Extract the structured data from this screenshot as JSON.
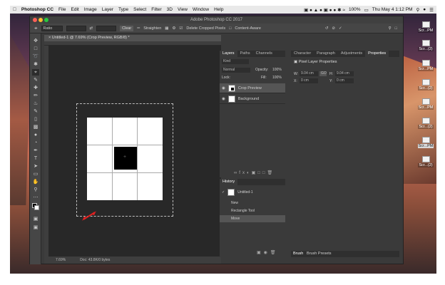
{
  "menubar": {
    "app": "Photoshop CC",
    "items": [
      "File",
      "Edit",
      "Image",
      "Layer",
      "Type",
      "Select",
      "Filter",
      "3D",
      "View",
      "Window",
      "Help"
    ],
    "battery": "100%",
    "clock": "Thu May 4 1:12 PM"
  },
  "window": {
    "title": "Adobe Photoshop CC 2017"
  },
  "options": {
    "ratio": "Ratio",
    "clear": "Clear",
    "straighten": "Straighten",
    "delete_cropped": "Delete Cropped Pixels",
    "content_aware": "Content-Aware"
  },
  "document": {
    "tab": "Untitled-1 @ 7.69% (Crop Preview, RGB/8) *",
    "zoom": "7.69%",
    "doc_info": "Doc: 43.8K/0 bytes"
  },
  "layers_panel": {
    "tabs": [
      "Layers",
      "Paths",
      "Channels"
    ],
    "active_tab": "Layers",
    "blend_mode": "Normal",
    "opacity_label": "Opacity:",
    "opacity": "100%",
    "lock_label": "Lock:",
    "fill_label": "Fill:",
    "fill": "100%",
    "kind": "Kind",
    "layers": [
      {
        "name": "Crop Preview",
        "thumb": "black-square"
      },
      {
        "name": "Background",
        "thumb": "white"
      }
    ]
  },
  "history_panel": {
    "title": "History",
    "snapshot": "Untitled-1",
    "items": [
      "New",
      "Rectangle Tool",
      "Move"
    ],
    "selected": "Move"
  },
  "properties_panel": {
    "tabs": [
      "Character",
      "Paragraph",
      "Adjustments",
      "Properties"
    ],
    "active_tab": "Properties",
    "heading": "Pixel Layer Properties",
    "w_label": "W:",
    "w": "9.04 cm",
    "h_label": "H:",
    "h": "9.04 cm",
    "x_label": "X:",
    "x": "0 cm",
    "y_label": "Y:",
    "y": "0 cm",
    "link": "GO"
  },
  "brush_panel": {
    "tabs": [
      "Brush",
      "Brush Presets"
    ],
    "active_tab": "Brush"
  },
  "desktop_icons": [
    {
      "label": "Scr...PM"
    },
    {
      "label": "Scr...(2)"
    },
    {
      "label": "Scr...PM"
    },
    {
      "label": "Scr...(2)"
    },
    {
      "label": "Scr...PM"
    },
    {
      "label": "Scr...(2)"
    },
    {
      "label": "Scr...PM"
    },
    {
      "label": "Scr...(2)"
    }
  ],
  "colors": {
    "accent_arrow": "#e02020",
    "panel_bg": "#3a3a3a",
    "canvas_bg": "#282828"
  }
}
